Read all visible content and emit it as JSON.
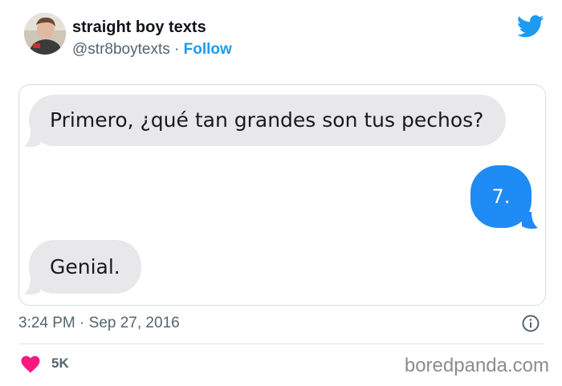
{
  "author": {
    "name": "straight boy texts",
    "handle": "@str8boytexts",
    "separator": " · ",
    "follow_label": "Follow"
  },
  "messages": [
    {
      "direction": "received",
      "text": "Primero, ¿qué tan grandes son tus pechos?"
    },
    {
      "direction": "sent",
      "text": "7."
    },
    {
      "direction": "received",
      "text": "Genial."
    }
  ],
  "tweet_meta": {
    "time": "3:24 PM",
    "separator": " · ",
    "date": "Sep 27, 2016"
  },
  "engagement": {
    "likes": "5K"
  },
  "watermark": "boredpanda.com",
  "colors": {
    "twitter_blue": "#1d9bf0",
    "imessage_blue": "#1f8bf5",
    "received_bubble": "#e8e8ea",
    "heart": "#f91880"
  },
  "icons": {
    "brand": "twitter-bird-icon",
    "info": "info-icon",
    "like": "heart-icon"
  }
}
